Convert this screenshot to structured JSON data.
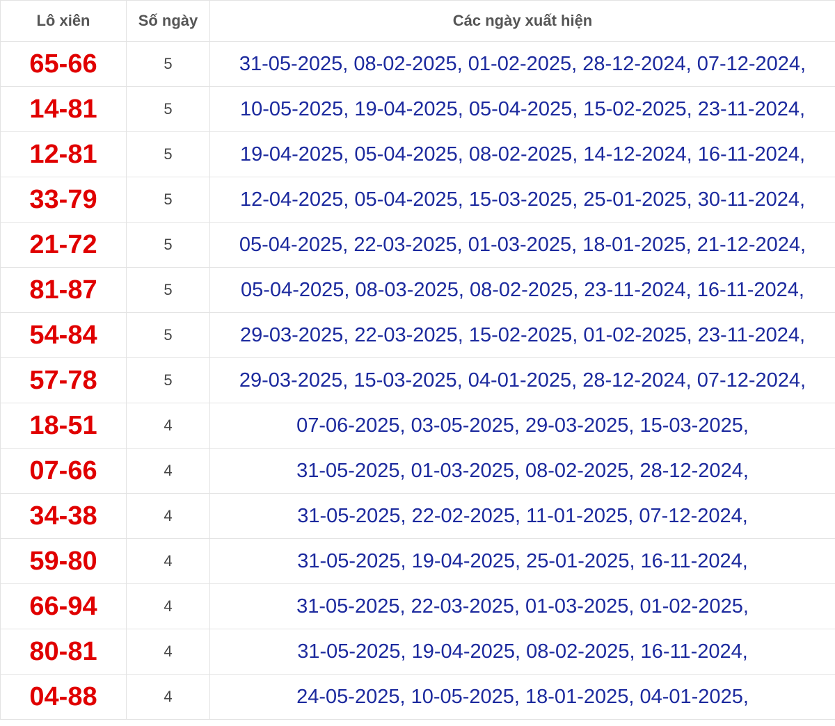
{
  "table": {
    "headers": {
      "pair": "Lô xiên",
      "count": "Số ngày",
      "dates": "Các ngày xuất hiện"
    },
    "rows": [
      {
        "pair": "65-66",
        "count": "5",
        "dates": "31-05-2025, 08-02-2025, 01-02-2025, 28-12-2024, 07-12-2024,"
      },
      {
        "pair": "14-81",
        "count": "5",
        "dates": "10-05-2025, 19-04-2025, 05-04-2025, 15-02-2025, 23-11-2024,"
      },
      {
        "pair": "12-81",
        "count": "5",
        "dates": "19-04-2025, 05-04-2025, 08-02-2025, 14-12-2024, 16-11-2024,"
      },
      {
        "pair": "33-79",
        "count": "5",
        "dates": "12-04-2025, 05-04-2025, 15-03-2025, 25-01-2025, 30-11-2024,"
      },
      {
        "pair": "21-72",
        "count": "5",
        "dates": "05-04-2025, 22-03-2025, 01-03-2025, 18-01-2025, 21-12-2024,"
      },
      {
        "pair": "81-87",
        "count": "5",
        "dates": "05-04-2025, 08-03-2025, 08-02-2025, 23-11-2024, 16-11-2024,"
      },
      {
        "pair": "54-84",
        "count": "5",
        "dates": "29-03-2025, 22-03-2025, 15-02-2025, 01-02-2025, 23-11-2024,"
      },
      {
        "pair": "57-78",
        "count": "5",
        "dates": "29-03-2025, 15-03-2025, 04-01-2025, 28-12-2024, 07-12-2024,"
      },
      {
        "pair": "18-51",
        "count": "4",
        "dates": "07-06-2025, 03-05-2025, 29-03-2025, 15-03-2025,"
      },
      {
        "pair": "07-66",
        "count": "4",
        "dates": "31-05-2025, 01-03-2025, 08-02-2025, 28-12-2024,"
      },
      {
        "pair": "34-38",
        "count": "4",
        "dates": "31-05-2025, 22-02-2025, 11-01-2025, 07-12-2024,"
      },
      {
        "pair": "59-80",
        "count": "4",
        "dates": "31-05-2025, 19-04-2025, 25-01-2025, 16-11-2024,"
      },
      {
        "pair": "66-94",
        "count": "4",
        "dates": "31-05-2025, 22-03-2025, 01-03-2025, 01-02-2025,"
      },
      {
        "pair": "80-81",
        "count": "4",
        "dates": "31-05-2025, 19-04-2025, 08-02-2025, 16-11-2024,"
      },
      {
        "pair": "04-88",
        "count": "4",
        "dates": "24-05-2025, 10-05-2025, 18-01-2025, 04-01-2025,"
      }
    ]
  },
  "colors": {
    "pair_text": "#e00000",
    "dates_text": "#1c2a9e",
    "header_text": "#555555",
    "border": "#e3e3e3"
  }
}
